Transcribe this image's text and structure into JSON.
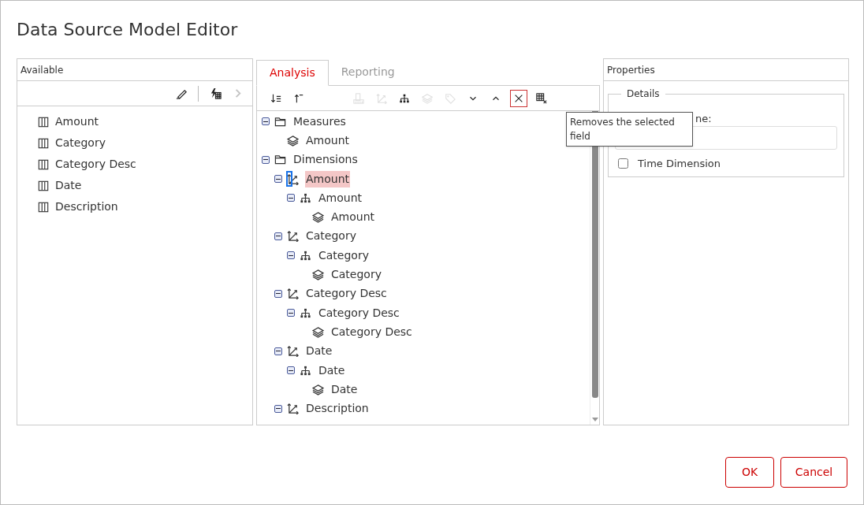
{
  "window": {
    "title": "Data Source Model Editor"
  },
  "available": {
    "title": "Available",
    "toolbar": [
      {
        "kind": "edit",
        "disabled": false
      },
      {
        "kind": "calc",
        "disabled": false
      },
      {
        "kind": "next",
        "disabled": true
      }
    ],
    "fields": [
      "Amount",
      "Category",
      "Category Desc",
      "Date",
      "Description"
    ]
  },
  "model": {
    "tabs": [
      {
        "label": "Analysis",
        "selected": true
      },
      {
        "label": "Reporting",
        "selected": false
      }
    ],
    "toolbar": [
      {
        "kind": "sort-desc",
        "disabled": false,
        "hovered": false
      },
      {
        "kind": "sort-asc",
        "disabled": false,
        "hovered": false
      },
      {
        "kind": "ruler",
        "disabled": true,
        "hovered": false
      },
      {
        "kind": "axes",
        "disabled": true,
        "hovered": false
      },
      {
        "kind": "hierarchy",
        "disabled": false,
        "hovered": false
      },
      {
        "kind": "layers",
        "disabled": true,
        "hovered": false
      },
      {
        "kind": "tag",
        "disabled": true,
        "hovered": false
      },
      {
        "kind": "down",
        "disabled": false,
        "hovered": false
      },
      {
        "kind": "up",
        "disabled": false,
        "hovered": false
      },
      {
        "kind": "remove",
        "disabled": false,
        "hovered": true
      },
      {
        "kind": "grid-remove",
        "disabled": false,
        "hovered": false
      }
    ],
    "tooltip": "Removes the selected field",
    "tree": [
      {
        "kind": "folder",
        "label": "Measures",
        "expanded": true,
        "selected": false,
        "children": [
          {
            "kind": "measure",
            "label": "Amount",
            "selected": false
          }
        ]
      },
      {
        "kind": "folder",
        "label": "Dimensions",
        "expanded": true,
        "selected": false,
        "children": [
          {
            "kind": "dimension",
            "label": "Amount",
            "expanded": true,
            "selected": true,
            "children": [
              {
                "kind": "hierarchy",
                "label": "Amount",
                "expanded": true,
                "selected": false,
                "children": [
                  {
                    "kind": "level",
                    "label": "Amount",
                    "selected": false
                  }
                ]
              }
            ]
          },
          {
            "kind": "dimension",
            "label": "Category",
            "expanded": true,
            "selected": false,
            "children": [
              {
                "kind": "hierarchy",
                "label": "Category",
                "expanded": true,
                "selected": false,
                "children": [
                  {
                    "kind": "level",
                    "label": "Category",
                    "selected": false
                  }
                ]
              }
            ]
          },
          {
            "kind": "dimension",
            "label": "Category Desc",
            "expanded": true,
            "selected": false,
            "children": [
              {
                "kind": "hierarchy",
                "label": "Category Desc",
                "expanded": true,
                "selected": false,
                "children": [
                  {
                    "kind": "level",
                    "label": "Category Desc",
                    "selected": false
                  }
                ]
              }
            ]
          },
          {
            "kind": "dimension",
            "label": "Date",
            "expanded": true,
            "selected": false,
            "children": [
              {
                "kind": "hierarchy",
                "label": "Date",
                "expanded": true,
                "selected": false,
                "children": [
                  {
                    "kind": "level",
                    "label": "Date",
                    "selected": false
                  }
                ]
              }
            ]
          },
          {
            "kind": "dimension",
            "label": "Description",
            "expanded": true,
            "selected": false
          }
        ]
      }
    ]
  },
  "properties": {
    "title": "Properties",
    "group": "Details",
    "name_label": "ne:",
    "time_dimension": {
      "label": "Time Dimension",
      "checked": false
    }
  },
  "buttons": [
    "OK",
    "Cancel"
  ]
}
